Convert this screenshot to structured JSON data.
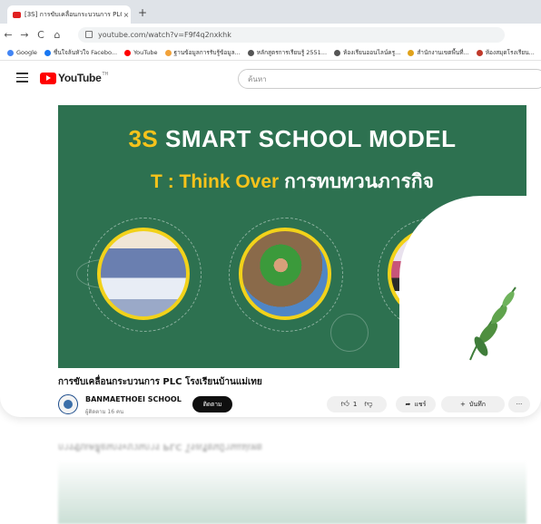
{
  "browser": {
    "tab_title": "[3S] การขับเคลื่อนกระบวนการ PLC",
    "tab_close": "×",
    "new_tab": "+",
    "nav": {
      "back": "←",
      "forward": "→",
      "reload": "C",
      "home": "⌂"
    },
    "url": "youtube.com/watch?v=F9f4q2nxkhk",
    "bookmarks": [
      {
        "label": "Google",
        "color": "#4285f4"
      },
      {
        "label": "ชื่นใจล้นหัวใจ Facebo...",
        "color": "#1877f2"
      },
      {
        "label": "YouTube",
        "color": "#ff0000"
      },
      {
        "label": "ฐานข้อมูลการรับรู้ข้อมูล...",
        "color": "#f2a23a"
      },
      {
        "label": "หลักสูตรการเรียนรู้ 2551...",
        "color": "#555555"
      },
      {
        "label": "ห้องเรียนออนไลน์ครู...",
        "color": "#555555"
      },
      {
        "label": "สำนักงานเขตพื้นที่...",
        "color": "#e0a21b"
      },
      {
        "label": "ห้องสมุดโรงเรียน...",
        "color": "#c0392b"
      }
    ]
  },
  "youtube": {
    "logo_text": "YouTube",
    "country": "TH",
    "search_placeholder": "ค้นหา"
  },
  "video": {
    "headline_main": "SMART SCHOOL MODEL",
    "headline_prefix": "3S",
    "sub_label": "T : Think Over",
    "sub_thai": "การทบทวนภารกิจ",
    "title": "การขับเคลื่อนกระบวนการ PLC โรงเรียนบ้านแม่เทย",
    "accent_green": "#2d7150",
    "accent_yellow": "#f6c31b"
  },
  "channel": {
    "name": "BANMAETHOEI SCHOOL",
    "subscribers": "ผู้ติดตาม 16 คน",
    "subscribe_label": "ติดตาม"
  },
  "actions": {
    "like_icon": "like-icon",
    "like_count": "1",
    "dislike_icon": "dislike-icon",
    "share_label": "แชร์",
    "save_label": "บันทึก",
    "more": "···"
  }
}
